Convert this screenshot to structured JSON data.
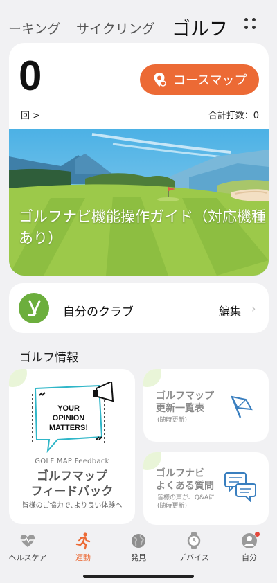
{
  "tabs": {
    "running": "ーキング",
    "cycling": "サイクリング",
    "golf": "ゴルフ"
  },
  "summary": {
    "count": "0",
    "count_unit": "回 >",
    "course_map_button": "コースマップ",
    "total_strokes": "合計打数：0"
  },
  "banner": {
    "title": "ゴルフナビ機能操作ガイド（対応機種あり）"
  },
  "clubs": {
    "label": "自分のクラブ",
    "edit": "編集",
    "chevron": "›"
  },
  "golf_info": {
    "section_title": "ゴルフ情報",
    "feedback": {
      "badge_line1": "YOUR",
      "badge_line2": "OPINION",
      "badge_line3": "MATTERS!",
      "subtitle": "GOLF MAP Feedback",
      "title_line1": "ゴルフマップ",
      "title_line2": "フィードバック",
      "note": "皆様のご協力で､より良い体験へ"
    },
    "update_list": {
      "title_line1": "ゴルフマップ",
      "title_line2": "更新一覧表",
      "note": "(随時更新)"
    },
    "faq": {
      "title_line1": "ゴルフナビ",
      "title_line2": "よくある質問",
      "note_line1": "皆様の声が、Q&Aに",
      "note_line2": "(随時更新)"
    }
  },
  "bottom_nav": [
    {
      "label": "ヘルスケア",
      "icon": "heart-pulse-icon"
    },
    {
      "label": "運動",
      "icon": "runner-icon"
    },
    {
      "label": "発見",
      "icon": "globe-icon"
    },
    {
      "label": "デバイス",
      "icon": "watch-icon"
    },
    {
      "label": "自分",
      "icon": "person-icon"
    }
  ],
  "colors": {
    "accent": "#ec6a35",
    "grass": "#6cae3d",
    "sky": "#5bb8e6"
  }
}
